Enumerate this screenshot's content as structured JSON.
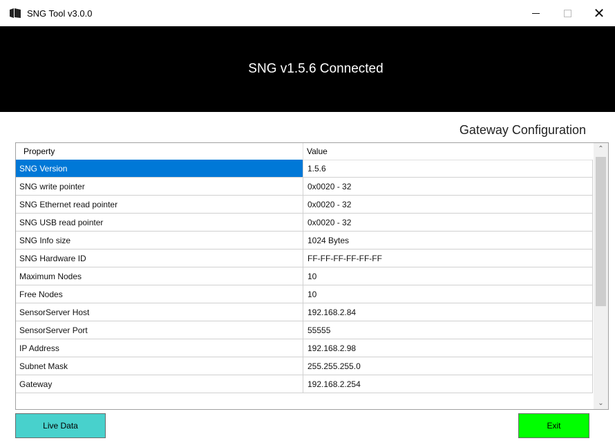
{
  "window": {
    "title": "SNG Tool v3.0.0",
    "controls": {
      "minimize": "minimize",
      "maximize": "maximize",
      "close": "✕"
    }
  },
  "banner": {
    "status_text": "SNG v1.5.6 Connected"
  },
  "section": {
    "title": "Gateway Configuration"
  },
  "grid": {
    "columns": [
      "Property",
      "Value"
    ],
    "rows": [
      {
        "property": "SNG Version",
        "value": "1.5.6",
        "selected": true
      },
      {
        "property": "SNG write pointer",
        "value": "0x0020 - 32"
      },
      {
        "property": "SNG Ethernet read pointer",
        "value": "0x0020 - 32"
      },
      {
        "property": "SNG USB read pointer",
        "value": "0x0020 - 32"
      },
      {
        "property": "SNG Info size",
        "value": "1024 Bytes"
      },
      {
        "property": "SNG Hardware ID",
        "value": "FF-FF-FF-FF-FF-FF"
      },
      {
        "property": "Maximum Nodes",
        "value": "10"
      },
      {
        "property": "Free Nodes",
        "value": "10"
      },
      {
        "property": "SensorServer Host",
        "value": "192.168.2.84"
      },
      {
        "property": "SensorServer Port",
        "value": "55555"
      },
      {
        "property": "IP Address",
        "value": "192.168.2.98"
      },
      {
        "property": "Subnet Mask",
        "value": "255.255.255.0"
      },
      {
        "property": "Gateway",
        "value": "192.168.2.254"
      }
    ]
  },
  "buttons": {
    "live_data": "Live Data",
    "exit": "Exit"
  },
  "colors": {
    "banner_bg": "#000000",
    "selection": "#0078d7",
    "live_data_button": "#48d1cc",
    "exit_button": "#00ff00"
  },
  "icons": {
    "app": "book-icon",
    "scroll_up": "chevron-up-icon",
    "scroll_down": "chevron-down-icon"
  }
}
